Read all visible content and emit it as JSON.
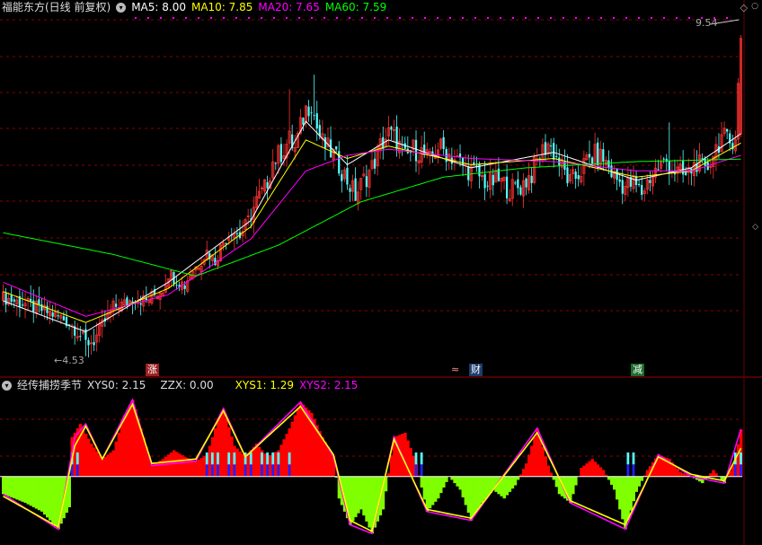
{
  "colors": {
    "bg": "#000000",
    "up": "#ff3232",
    "down": "#54ffff",
    "ma5": "#ffffff",
    "ma10": "#ffff00",
    "ma20": "#ff00ff",
    "ma60": "#00ff00",
    "xys0_pos": "#ff0000",
    "xys0_neg": "#7fff00",
    "xys1": "#ffff00",
    "xys2": "#ff00ff",
    "bar_cyan": "#54ffff",
    "bar_blue": "#2020ff",
    "grid": "#8b0000"
  },
  "main_panel": {
    "title": "福能东方(日线 前复权)",
    "ma5_label": "MA5: 8.00",
    "ma10_label": "MA10: 7.85",
    "ma20_label": "MA20: 7.65",
    "ma60_label": "MA60: 7.59",
    "high_label": "9.54",
    "low_label": "4.53",
    "collapse_icon": "chevron-down-icon"
  },
  "markers": [
    {
      "text": "涨",
      "bg": "#9b2020"
    },
    {
      "text": "财",
      "bg": "#1c3c6c",
      "prefix": "≈"
    },
    {
      "text": "减",
      "bg": "#1c6c2c"
    }
  ],
  "indicator_panel": {
    "title": "经传捕捞季节",
    "xys0_label": "XYS0: 2.15",
    "zzx_label": "ZZX: 0.00",
    "xys1_label": "XYS1: 1.29",
    "xys2_label": "XYS2: 2.15"
  },
  "chart_data": [
    {
      "type": "candlestick",
      "title": "福能东方(日线 前复权)",
      "ylim": [
        4.3,
        9.9
      ],
      "annotations": [
        "9.54",
        "4.53"
      ],
      "close_path": [
        [
          0,
          5.35
        ],
        [
          8,
          5.25
        ],
        [
          14,
          5.15
        ],
        [
          20,
          5.05
        ],
        [
          24,
          4.95
        ],
        [
          28,
          4.75
        ],
        [
          30,
          4.62
        ],
        [
          33,
          4.65
        ],
        [
          36,
          4.9
        ],
        [
          40,
          5.2
        ],
        [
          44,
          5.25
        ],
        [
          48,
          5.35
        ],
        [
          52,
          5.3
        ],
        [
          55,
          5.4
        ],
        [
          58,
          5.5
        ],
        [
          60,
          5.75
        ],
        [
          63,
          5.65
        ],
        [
          66,
          5.55
        ],
        [
          68,
          5.75
        ],
        [
          71,
          5.9
        ],
        [
          74,
          6.1
        ],
        [
          77,
          5.95
        ],
        [
          80,
          6.25
        ],
        [
          83,
          6.45
        ],
        [
          86,
          6.35
        ],
        [
          89,
          6.6
        ],
        [
          92,
          6.9
        ],
        [
          95,
          7.1
        ],
        [
          98,
          7.55
        ],
        [
          101,
          7.7
        ],
        [
          104,
          7.9
        ],
        [
          106,
          7.75
        ],
        [
          108,
          8.1
        ],
        [
          110,
          8.4
        ],
        [
          112,
          8.5
        ],
        [
          114,
          8.1
        ],
        [
          116,
          7.85
        ],
        [
          118,
          7.75
        ],
        [
          120,
          7.65
        ],
        [
          122,
          7.5
        ],
        [
          125,
          7.25
        ],
        [
          128,
          7.0
        ],
        [
          131,
          7.25
        ],
        [
          134,
          7.45
        ],
        [
          137,
          7.8
        ],
        [
          140,
          8.0
        ],
        [
          143,
          7.9
        ],
        [
          146,
          7.6
        ],
        [
          149,
          7.75
        ],
        [
          152,
          7.7
        ],
        [
          155,
          7.55
        ],
        [
          158,
          7.8
        ],
        [
          161,
          7.7
        ],
        [
          164,
          7.6
        ],
        [
          168,
          7.45
        ],
        [
          172,
          7.35
        ],
        [
          176,
          7.2
        ],
        [
          180,
          7.25
        ],
        [
          184,
          7.1
        ],
        [
          188,
          7.15
        ],
        [
          192,
          7.35
        ],
        [
          195,
          7.65
        ],
        [
          198,
          7.85
        ],
        [
          200,
          7.7
        ],
        [
          203,
          7.45
        ],
        [
          206,
          7.2
        ],
        [
          209,
          7.35
        ],
        [
          212,
          7.55
        ],
        [
          215,
          7.65
        ],
        [
          218,
          7.6
        ],
        [
          222,
          7.3
        ],
        [
          226,
          7.15
        ],
        [
          229,
          7.2
        ],
        [
          232,
          7.05
        ],
        [
          235,
          7.3
        ],
        [
          238,
          7.45
        ],
        [
          241,
          7.55
        ],
        [
          244,
          7.4
        ],
        [
          248,
          7.3
        ],
        [
          252,
          7.55
        ],
        [
          255,
          7.35
        ],
        [
          258,
          7.7
        ],
        [
          261,
          7.95
        ],
        [
          264,
          7.85
        ],
        [
          266,
          8.0
        ],
        [
          268,
          9.54
        ]
      ],
      "ma_path": {
        "MA5": [
          [
            0,
            5.3
          ],
          [
            30,
            4.8
          ],
          [
            60,
            5.6
          ],
          [
            90,
            6.6
          ],
          [
            110,
            8.2
          ],
          [
            125,
            7.5
          ],
          [
            140,
            7.9
          ],
          [
            170,
            7.45
          ],
          [
            200,
            7.7
          ],
          [
            230,
            7.25
          ],
          [
            250,
            7.45
          ],
          [
            268,
            8.0
          ]
        ],
        "MA10": [
          [
            0,
            5.45
          ],
          [
            30,
            4.95
          ],
          [
            60,
            5.5
          ],
          [
            90,
            6.5
          ],
          [
            110,
            7.9
          ],
          [
            125,
            7.6
          ],
          [
            140,
            7.8
          ],
          [
            170,
            7.5
          ],
          [
            200,
            7.6
          ],
          [
            230,
            7.3
          ],
          [
            250,
            7.4
          ],
          [
            268,
            7.85
          ]
        ],
        "MA20": [
          [
            0,
            5.6
          ],
          [
            30,
            5.05
          ],
          [
            60,
            5.4
          ],
          [
            90,
            6.3
          ],
          [
            110,
            7.4
          ],
          [
            125,
            7.65
          ],
          [
            140,
            7.75
          ],
          [
            170,
            7.6
          ],
          [
            200,
            7.55
          ],
          [
            230,
            7.4
          ],
          [
            250,
            7.4
          ],
          [
            268,
            7.65
          ]
        ],
        "MA60": [
          [
            0,
            6.4
          ],
          [
            40,
            6.05
          ],
          [
            70,
            5.7
          ],
          [
            100,
            6.2
          ],
          [
            130,
            6.9
          ],
          [
            160,
            7.3
          ],
          [
            190,
            7.45
          ],
          [
            230,
            7.55
          ],
          [
            268,
            7.59
          ]
        ]
      }
    },
    {
      "type": "line",
      "title": "经传捕捞季节",
      "ylim": [
        -3.0,
        3.8
      ],
      "series": [
        {
          "name": "XYS0",
          "values": [
            [
              0,
              -0.8
            ],
            [
              8,
              -1.2
            ],
            [
              14,
              -1.6
            ],
            [
              20,
              -2.4
            ],
            [
              24,
              -1.4
            ],
            [
              25,
              1.8
            ],
            [
              28,
              2.4
            ],
            [
              32,
              1.5
            ],
            [
              36,
              0.8
            ],
            [
              40,
              1.2
            ],
            [
              44,
              2.8
            ],
            [
              47,
              3.5
            ],
            [
              50,
              2.2
            ],
            [
              54,
              0.5
            ],
            [
              58,
              0.8
            ],
            [
              62,
              1.2
            ],
            [
              66,
              0.9
            ],
            [
              70,
              0.7
            ],
            [
              74,
              1.0
            ],
            [
              78,
              2.6
            ],
            [
              80,
              3.1
            ],
            [
              84,
              1.4
            ],
            [
              88,
              0.9
            ],
            [
              92,
              1.5
            ],
            [
              96,
              0.9
            ],
            [
              100,
              1.2
            ],
            [
              104,
              2.2
            ],
            [
              108,
              3.4
            ],
            [
              112,
              2.9
            ],
            [
              116,
              1.8
            ],
            [
              120,
              0.9
            ],
            [
              122,
              -1.0
            ],
            [
              126,
              -2.2
            ],
            [
              130,
              -1.5
            ],
            [
              134,
              -2.6
            ],
            [
              138,
              -1.5
            ],
            [
              142,
              1.8
            ],
            [
              146,
              2.0
            ],
            [
              150,
              0.6
            ],
            [
              154,
              -1.6
            ],
            [
              158,
              -1.0
            ],
            [
              162,
              0.0
            ],
            [
              166,
              -0.6
            ],
            [
              170,
              -2.0
            ],
            [
              174,
              -1.2
            ],
            [
              178,
              -0.6
            ],
            [
              182,
              -1.0
            ],
            [
              186,
              -0.4
            ],
            [
              190,
              0.6
            ],
            [
              194,
              2.2
            ],
            [
              198,
              0.5
            ],
            [
              202,
              -0.8
            ],
            [
              206,
              -1.2
            ],
            [
              210,
              0.4
            ],
            [
              214,
              0.8
            ],
            [
              218,
              0.3
            ],
            [
              222,
              -0.6
            ],
            [
              226,
              -2.4
            ],
            [
              230,
              -0.7
            ],
            [
              234,
              0.3
            ],
            [
              238,
              1.0
            ],
            [
              242,
              0.8
            ],
            [
              246,
              0.2
            ],
            [
              250,
              0.0
            ],
            [
              254,
              -0.3
            ],
            [
              258,
              0.3
            ],
            [
              262,
              -0.3
            ],
            [
              266,
              0.8
            ],
            [
              268,
              2.15
            ]
          ]
        },
        {
          "name": "XYS1",
          "values": [
            [
              0,
              -0.9
            ],
            [
              20,
              -2.3
            ],
            [
              26,
              1.4
            ],
            [
              30,
              2.3
            ],
            [
              36,
              0.8
            ],
            [
              47,
              3.3
            ],
            [
              54,
              0.6
            ],
            [
              70,
              0.8
            ],
            [
              80,
              3.0
            ],
            [
              88,
              0.9
            ],
            [
              108,
              3.2
            ],
            [
              120,
              1.0
            ],
            [
              126,
              -2.0
            ],
            [
              134,
              -2.5
            ],
            [
              142,
              1.7
            ],
            [
              154,
              -1.5
            ],
            [
              170,
              -1.9
            ],
            [
              194,
              2.0
            ],
            [
              206,
              -1.1
            ],
            [
              226,
              -2.2
            ],
            [
              238,
              0.9
            ],
            [
              250,
              0.1
            ],
            [
              262,
              -0.2
            ],
            [
              268,
              1.29
            ]
          ]
        },
        {
          "name": "XYS2",
          "values": [
            [
              0,
              -0.8
            ],
            [
              20,
              -2.4
            ],
            [
              26,
              1.8
            ],
            [
              30,
              2.4
            ],
            [
              36,
              0.8
            ],
            [
              47,
              3.5
            ],
            [
              54,
              0.5
            ],
            [
              70,
              0.7
            ],
            [
              80,
              3.1
            ],
            [
              88,
              0.9
            ],
            [
              108,
              3.4
            ],
            [
              120,
              0.9
            ],
            [
              126,
              -2.2
            ],
            [
              134,
              -2.6
            ],
            [
              142,
              1.8
            ],
            [
              154,
              -1.6
            ],
            [
              170,
              -2.0
            ],
            [
              194,
              2.2
            ],
            [
              206,
              -1.2
            ],
            [
              226,
              -2.4
            ],
            [
              238,
              1.0
            ],
            [
              250,
              0.0
            ],
            [
              262,
              -0.3
            ],
            [
              268,
              2.15
            ]
          ]
        }
      ]
    }
  ]
}
